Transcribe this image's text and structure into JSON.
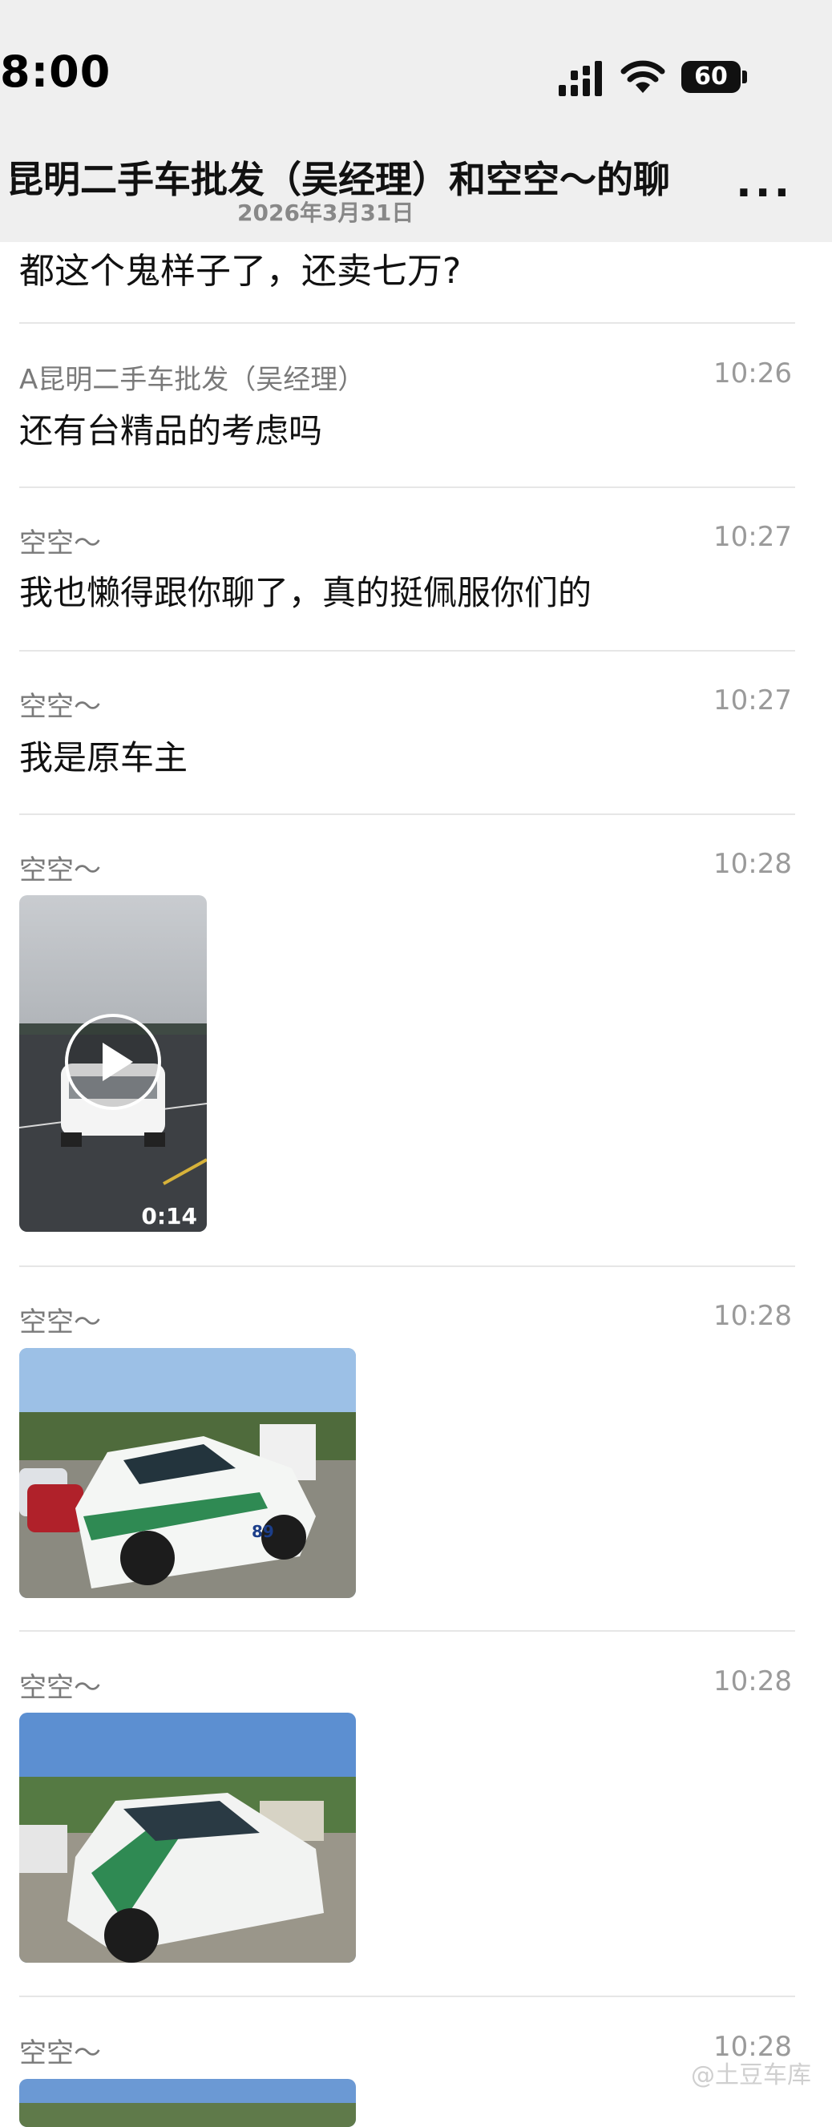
{
  "status": {
    "time": "8:00",
    "battery": "60"
  },
  "header": {
    "title": "昆明二手车批发（吴经理）和空空～的聊",
    "date": "2026年3月31日",
    "more": "..."
  },
  "partial_message": "都这个鬼样子了，还卖七万?",
  "messages": [
    {
      "sender": "A昆明二手车批发（吴经理）",
      "time": "10:26",
      "text": "还有台精品的考虑吗"
    },
    {
      "sender": "空空～",
      "time": "10:27",
      "text": "我也懒得跟你聊了，真的挺佩服你们的"
    },
    {
      "sender": "空空～",
      "time": "10:27",
      "text": "我是原车主"
    },
    {
      "sender": "空空～",
      "time": "10:28",
      "video_duration": "0:14",
      "car_number": "89"
    },
    {
      "sender": "空空～",
      "time": "10:28"
    },
    {
      "sender": "空空～",
      "time": "10:28"
    },
    {
      "sender": "空空～",
      "time": "10:28"
    }
  ],
  "watermark": "@土豆车库"
}
